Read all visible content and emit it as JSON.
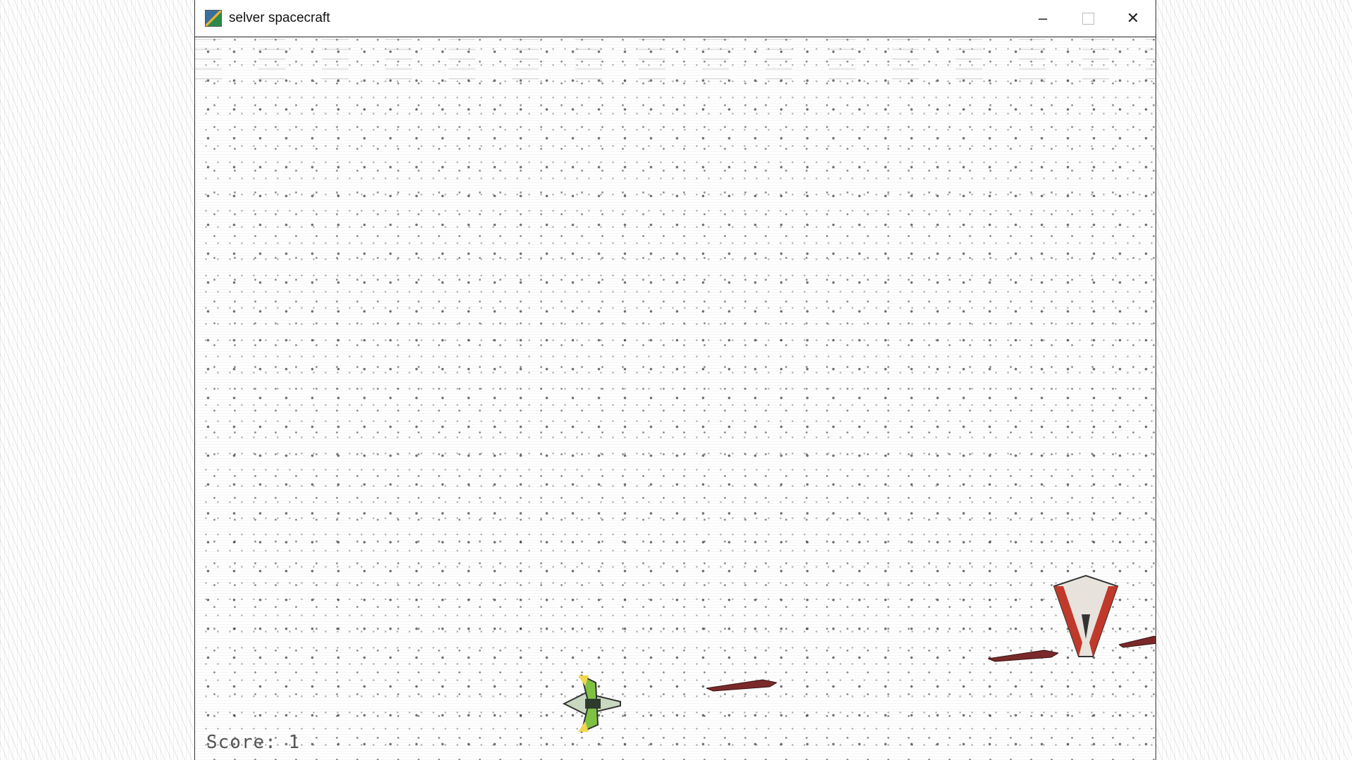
{
  "window": {
    "title": "selver spacecraft",
    "icon": "app-icon",
    "buttons": {
      "minimize": "–",
      "maximize": "",
      "close": "✕"
    }
  },
  "hud": {
    "score_text": "Score: 1"
  },
  "colors": {
    "player_body": "#7fc242",
    "player_wing": "#c9d8c0",
    "enemy_body": "#e8e2dc",
    "enemy_trim": "#c0392b",
    "bullet": "#7a2a2a"
  }
}
